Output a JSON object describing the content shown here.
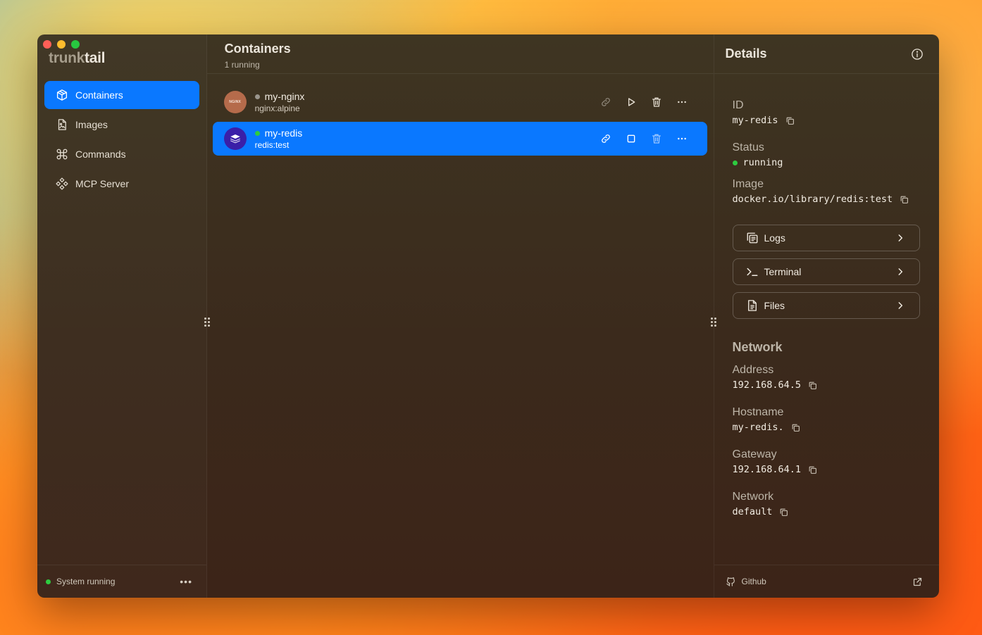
{
  "brand": {
    "part1": "trunk",
    "part2": "tail"
  },
  "sidebar": {
    "items": [
      {
        "label": "Containers",
        "icon": "box-icon",
        "active": true
      },
      {
        "label": "Images",
        "icon": "file-image-icon",
        "active": false
      },
      {
        "label": "Commands",
        "icon": "command-icon",
        "active": false
      },
      {
        "label": "MCP Server",
        "icon": "mcp-icon",
        "active": false
      }
    ],
    "status": "System running"
  },
  "main": {
    "title": "Containers",
    "subtitle": "1 running",
    "containers": [
      {
        "name": "my-nginx",
        "image": "nginx:alpine",
        "avatar_text": "NGINX",
        "status": "stopped",
        "selected": false
      },
      {
        "name": "my-redis",
        "image": "redis:test",
        "status": "running",
        "selected": true
      }
    ]
  },
  "details": {
    "title": "Details",
    "id_label": "ID",
    "id_value": "my-redis",
    "status_label": "Status",
    "status_value": "running",
    "image_label": "Image",
    "image_value": "docker.io/library/redis:test",
    "buttons": {
      "logs": "Logs",
      "terminal": "Terminal",
      "files": "Files"
    },
    "network_title": "Network",
    "address_label": "Address",
    "address_value": "192.168.64.5",
    "hostname_label": "Hostname",
    "hostname_value": "my-redis.",
    "gateway_label": "Gateway",
    "gateway_value": "192.168.64.1",
    "network_label": "Network",
    "network_value": "default",
    "footer_link": "Github"
  },
  "colors": {
    "accent": "#0a78ff",
    "running": "#2ecc40",
    "stopped": "#9a958c"
  }
}
